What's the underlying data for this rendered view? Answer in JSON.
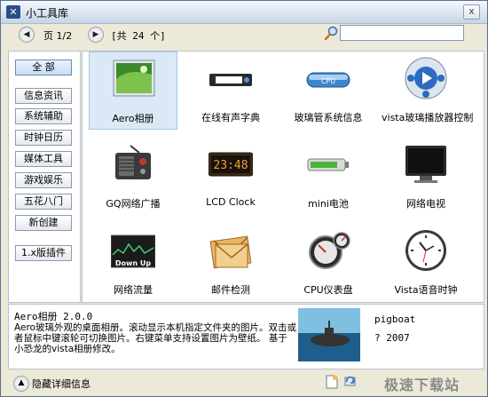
{
  "window": {
    "title": "小工具库",
    "close": "x"
  },
  "toolbar": {
    "prev": "◀",
    "page_text": "页 1/2",
    "next": "▶",
    "total_text": "[共 24 个]",
    "search_value": "",
    "search_icon": "magnifier-icon"
  },
  "sidebar": {
    "items": [
      {
        "label": "全 部",
        "active": true
      },
      {
        "label": "信息资讯"
      },
      {
        "label": "系统辅助"
      },
      {
        "label": "时钟日历"
      },
      {
        "label": "媒体工具"
      },
      {
        "label": "游戏娱乐"
      },
      {
        "label": "五花八门"
      },
      {
        "label": "新创建"
      },
      {
        "label": "1.x版插件"
      }
    ]
  },
  "gadgets": [
    {
      "label": "Aero相册",
      "icon": "aero-album-icon",
      "selected": true
    },
    {
      "label": "在线有声字典",
      "icon": "dictionary-icon"
    },
    {
      "label": "玻璃管系统信息",
      "icon": "cpu-glass-icon"
    },
    {
      "label": "vista玻璃播放器控制",
      "icon": "media-player-icon"
    },
    {
      "label": "GQ网络广播",
      "icon": "radio-icon"
    },
    {
      "label": "LCD Clock",
      "icon": "lcd-clock-icon"
    },
    {
      "label": "mini电池",
      "icon": "battery-icon"
    },
    {
      "label": "网络电视",
      "icon": "tv-icon"
    },
    {
      "label": "网络流量",
      "icon": "network-traffic-icon",
      "icon_text": "Down Up"
    },
    {
      "label": "邮件检测",
      "icon": "mail-icon"
    },
    {
      "label": "CPU仪表盘",
      "icon": "cpu-meter-icon"
    },
    {
      "label": "Vista语音时钟",
      "icon": "analog-clock-icon"
    }
  ],
  "lcd_text": "23:48",
  "cpu_text": "CPU",
  "detail": {
    "title": "Aero相册 2.0.0",
    "description": "Aero玻璃外观的桌面相册。滚动显示本机指定文件夹的图片。双击或者鼠标中键滚轮可切换图片。右键菜单支持设置图片为壁纸。 基于小恐龙的vista相册修改。",
    "author": "pigboat",
    "year": "? 2007"
  },
  "status": {
    "hide_label": "隐藏详细信息",
    "watermark": "极速下载站"
  },
  "colors": {
    "window_bg": "#ece9d8",
    "selection": "#dbe9f7",
    "border": "#b9c3cf"
  }
}
